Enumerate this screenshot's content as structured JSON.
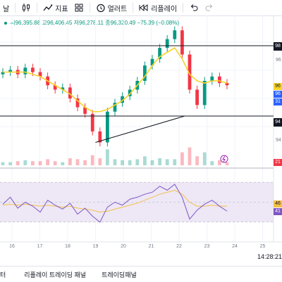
{
  "toolbar": {
    "interval_label": "날",
    "indicators_label": "지표",
    "alert_label": "얼러트",
    "replay_label": "리플레이"
  },
  "legend": {
    "open": "시96,395.88",
    "high": "고96,406.45",
    "low": "저96,278.11",
    "close": "종96,320.49",
    "change": "−75.39 (−0.08%)"
  },
  "price_axis": {
    "level_98": "98",
    "level_96": "96",
    "level_94": "94",
    "current_1": "96",
    "current_2": "31",
    "volume_badge": "21",
    "rsi_1": "46",
    "rsi_2": "41"
  },
  "clock": "14:28:21",
  "bottom_tabs": [
    "터",
    "리플레이 트레이딩 패널",
    "트레이딩패널"
  ],
  "colors": {
    "up": "#089981",
    "down": "#f23645",
    "ema": "#f5d32a",
    "rsi": "#7e57c2",
    "rsi_ma": "#f5c04a",
    "rsi_band": "#ede7f6"
  },
  "chart_data": [
    {
      "type": "line",
      "title": "",
      "x_ticks": [
        "16",
        "17",
        "18",
        "19",
        "20",
        "21",
        "22",
        "23",
        "24",
        "25"
      ],
      "ylim": [
        93.4,
        99.0
      ],
      "series": [
        {
          "name": "",
          "values": [
            97.0,
            97.1,
            96.9,
            97.2,
            97.0,
            96.8,
            96.4,
            96.2,
            96.3,
            95.8,
            95.4,
            95.1,
            94.3,
            93.8,
            95.2,
            95.6,
            95.9,
            96.2,
            96.6,
            97.3,
            97.6,
            98.1,
            98.5,
            98.9,
            97.8,
            96.2,
            95.5,
            96.6,
            96.8,
            96.5,
            96.4
          ]
        },
        {
          "name": "",
          "values": [
            97.0,
            97.0,
            97.0,
            97.0,
            96.9,
            96.8,
            96.6,
            96.4,
            96.2,
            96.0,
            95.7,
            95.4,
            95.2,
            95.2,
            95.3,
            95.5,
            95.7,
            96.0,
            96.4,
            96.8,
            97.3,
            97.7,
            97.9,
            98.1,
            97.6,
            96.9,
            96.6,
            96.5,
            96.6,
            96.6,
            96.5
          ]
        }
      ],
      "horizontal_levels": [
        98.2,
        95.0
      ],
      "trendline": {
        "from": [
          19.0,
          93.8
        ],
        "to": [
          22.2,
          95.0
        ]
      },
      "grid": true
    },
    {
      "type": "line",
      "title": "",
      "ylim": [
        20,
        80
      ],
      "band": [
        30,
        70
      ],
      "series": [
        {
          "name": "",
          "values": [
            48,
            55,
            44,
            50,
            46,
            40,
            52,
            47,
            43,
            49,
            38,
            44,
            36,
            30,
            45,
            50,
            47,
            53,
            55,
            58,
            60,
            66,
            62,
            68,
            55,
            33,
            42,
            48,
            52,
            46,
            41
          ]
        },
        {
          "name": "",
          "values": [
            47,
            48,
            47,
            48,
            47,
            46,
            47,
            46,
            45,
            46,
            44,
            43,
            42,
            40,
            41,
            43,
            45,
            47,
            49,
            52,
            55,
            58,
            60,
            62,
            58,
            50,
            46,
            46,
            47,
            46,
            46
          ]
        }
      ]
    }
  ]
}
